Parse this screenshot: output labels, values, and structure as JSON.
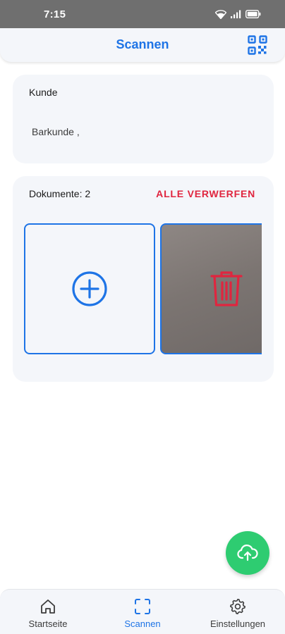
{
  "status_bar": {
    "time": "7:15"
  },
  "header": {
    "title": "Scannen"
  },
  "customer": {
    "label": "Kunde",
    "value": "Barkunde ,"
  },
  "documents": {
    "count_label": "Dokumente: 2",
    "discard_all": "ALLE VERWERFEN"
  },
  "nav": {
    "items": [
      {
        "label": "Startseite",
        "icon": "home-icon"
      },
      {
        "label": "Scannen",
        "icon": "scan-icon",
        "active": true
      },
      {
        "label": "Einstellungen",
        "icon": "gear-icon"
      }
    ]
  },
  "colors": {
    "accent": "#1e74e6",
    "danger": "#e0253f",
    "fab": "#2ecc71"
  }
}
